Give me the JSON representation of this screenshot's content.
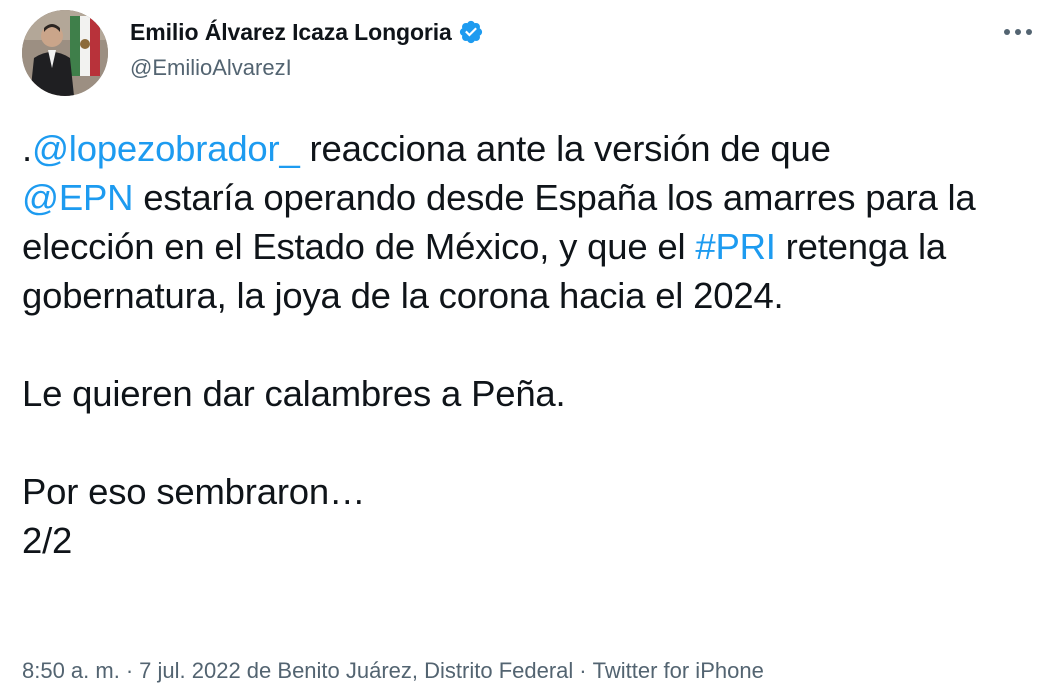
{
  "author": {
    "display_name": "Emilio Álvarez Icaza Longoria",
    "handle": "@EmilioAlvarezI",
    "verified": true
  },
  "icons": {
    "verified": "verified-badge-icon",
    "more": "more-options-icon"
  },
  "colors": {
    "accent": "#1d9bf0",
    "text": "#0f1419",
    "secondary": "#536471"
  },
  "tweet": {
    "p1_prefix": ".",
    "mention_1": "@lopezobrador_",
    "p1_text_a": " reacciona ante la versión de que ",
    "mention_2": "@EPN",
    "p1_text_b": " estaría operando desde España los amarres para la elección en el Estado de México, y que el ",
    "hashtag": "#PRI",
    "p1_text_c": " retenga la gobernatura, la joya de la corona hacia el 2024.",
    "p2": "Le quieren dar calambres a Peña.",
    "p3_line1": "Por eso sembraron…",
    "p3_line2": "2/2"
  },
  "meta": {
    "time": "8:50 a. m.",
    "separator": "·",
    "date_location": "7 jul. 2022 de Benito Juárez, Distrito Federal",
    "source": "Twitter for iPhone"
  }
}
